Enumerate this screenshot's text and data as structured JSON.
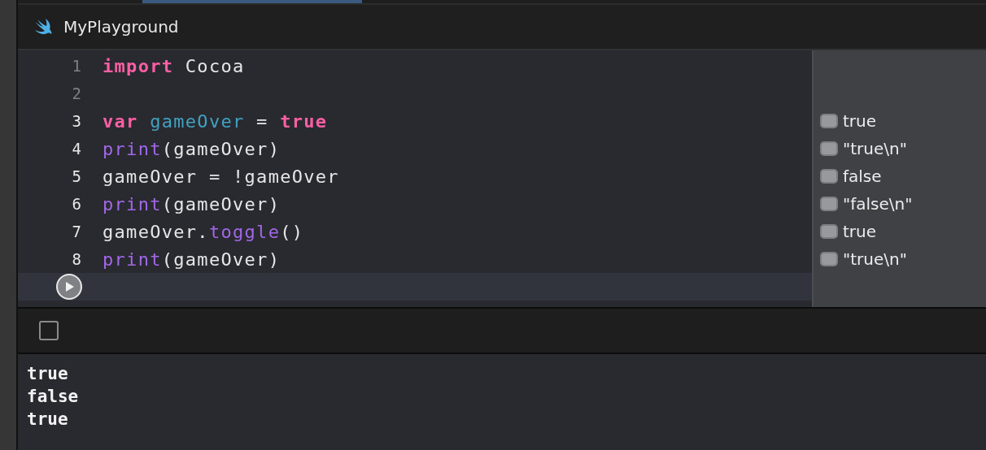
{
  "window": {
    "title": "MyPlayground"
  },
  "editor": {
    "lines": [
      {
        "number": "1",
        "executed": false,
        "tokens": [
          {
            "kind": "keyword",
            "text": "import"
          },
          {
            "kind": "plain",
            "text": " Cocoa"
          }
        ]
      },
      {
        "number": "2",
        "executed": false
      },
      {
        "number": "3",
        "executed": true,
        "tokens": [
          {
            "kind": "keyword",
            "text": "var"
          },
          {
            "kind": "declaration",
            "text": " gameOver"
          },
          {
            "kind": "plain",
            "text": " = "
          },
          {
            "kind": "keyword",
            "text": "true"
          }
        ],
        "result": "true"
      },
      {
        "number": "4",
        "executed": true,
        "tokens": [
          {
            "kind": "function",
            "text": "print"
          },
          {
            "kind": "plain",
            "text": "(gameOver)"
          }
        ],
        "result": "\"true\\n\""
      },
      {
        "number": "5",
        "executed": true,
        "tokens": [
          {
            "kind": "plain",
            "text": "gameOver = !gameOver"
          }
        ],
        "result": "false"
      },
      {
        "number": "6",
        "executed": true,
        "tokens": [
          {
            "kind": "function",
            "text": "print"
          },
          {
            "kind": "plain",
            "text": "(gameOver)"
          }
        ],
        "result": "\"false\\n\""
      },
      {
        "number": "7",
        "executed": true,
        "tokens": [
          {
            "kind": "plain",
            "text": "gameOver."
          },
          {
            "kind": "function",
            "text": "toggle"
          },
          {
            "kind": "plain",
            "text": "()"
          }
        ],
        "result": "true"
      },
      {
        "number": "8",
        "executed": true,
        "tokens": [
          {
            "kind": "function",
            "text": "print"
          },
          {
            "kind": "plain",
            "text": "(gameOver)"
          }
        ],
        "result": "\"true\\n\""
      }
    ],
    "run_row": {
      "highlighted": true
    }
  },
  "debug_toolbar": {
    "console_toggle_checked": false
  },
  "console": {
    "lines": [
      "true",
      "false",
      "true"
    ]
  }
}
